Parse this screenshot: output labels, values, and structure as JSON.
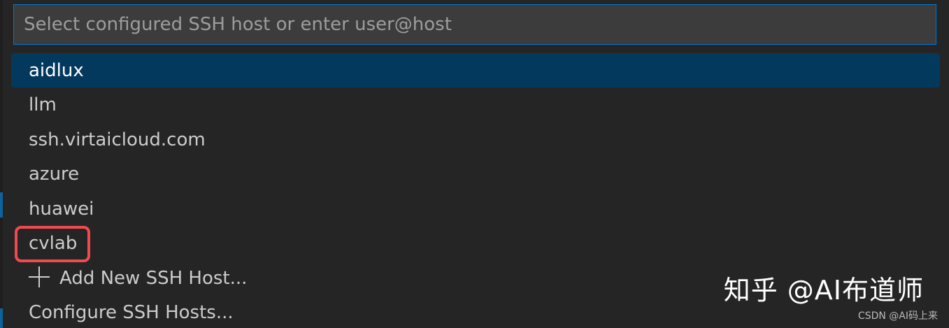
{
  "quick_pick": {
    "placeholder": "Select configured SSH host or enter user@host",
    "value": "",
    "items": [
      {
        "label": "aidlux",
        "selected": true
      },
      {
        "label": "llm"
      },
      {
        "label": "ssh.virtaicloud.com"
      },
      {
        "label": "azure"
      },
      {
        "label": "huawei"
      },
      {
        "label": "cvlab",
        "annotated": true
      },
      {
        "label": "Add New SSH Host...",
        "icon": "plus-icon"
      },
      {
        "label": "Configure SSH Hosts..."
      }
    ]
  },
  "annotation": {
    "color": "#f2494f"
  },
  "watermark": {
    "text": "知乎 @AI布道师",
    "source": "CSDN @AI码上来"
  },
  "colors": {
    "background": "#252526",
    "input_background": "#3c3c3c",
    "focus_border": "#0078d4",
    "selected_background": "#04395e",
    "text": "#cccccc"
  }
}
